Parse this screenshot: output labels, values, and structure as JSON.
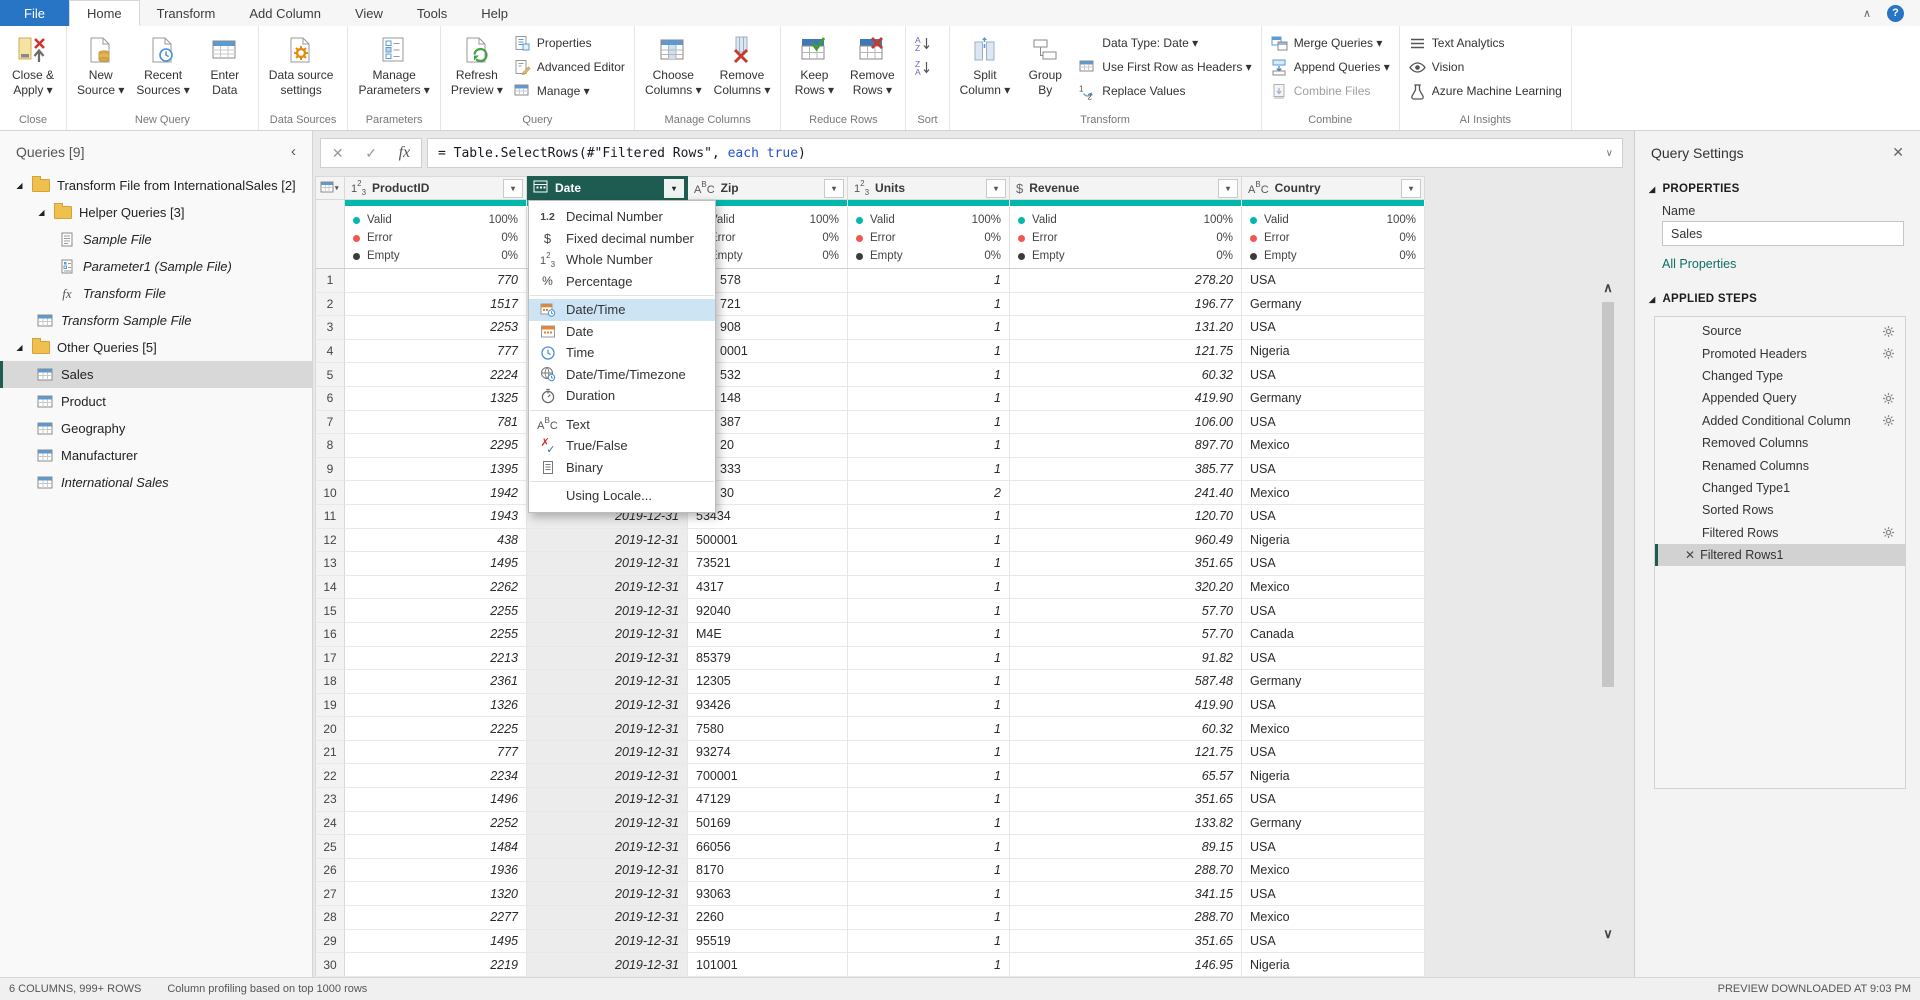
{
  "colors": {
    "accent_teal": "#01b8aa",
    "selected_header": "#1e5c52",
    "file_tab_blue": "#2775c4",
    "error_red": "#f2574f",
    "empty_dark": "#3b3b3b",
    "link_teal": "#0e6f64",
    "menu_highlight": "#cde4f5"
  },
  "glyphs": {
    "dropdown": "▾",
    "collapse_left": "‹",
    "chevron_top": "∧",
    "chevron_up": "∧",
    "chevron_down": "∨",
    "expander": "◢",
    "close": "✕",
    "check": "✓",
    "cancel": "✕",
    "fx": "fx",
    "help": "?"
  },
  "tabs": {
    "items": [
      {
        "label": "File",
        "file": true
      },
      {
        "label": "Home",
        "active": true
      },
      {
        "label": "Transform"
      },
      {
        "label": "Add Column"
      },
      {
        "label": "View"
      },
      {
        "label": "Tools"
      },
      {
        "label": "Help"
      }
    ]
  },
  "ribbon": {
    "groups": [
      {
        "caption": "Close",
        "cols": [
          {
            "type": "bigs",
            "items": [
              {
                "line1": "Close &",
                "line2": "Apply ▾",
                "icon": "close-apply"
              }
            ]
          }
        ]
      },
      {
        "caption": "New Query",
        "cols": [
          {
            "type": "bigs",
            "items": [
              {
                "line1": "New",
                "line2": "Source ▾",
                "icon": "new-source"
              },
              {
                "line1": "Recent",
                "line2": "Sources ▾",
                "icon": "recent-sources"
              },
              {
                "line1": "Enter",
                "line2": "Data",
                "icon": "enter-data"
              }
            ]
          }
        ]
      },
      {
        "caption": "Data Sources",
        "cols": [
          {
            "type": "bigs",
            "items": [
              {
                "line1": "Data source",
                "line2": "settings",
                "icon": "datasource-settings"
              }
            ]
          }
        ]
      },
      {
        "caption": "Parameters",
        "cols": [
          {
            "type": "bigs",
            "items": [
              {
                "line1": "Manage",
                "line2": "Parameters ▾",
                "icon": "manage-parameters"
              }
            ]
          }
        ]
      },
      {
        "caption": "Query",
        "cols": [
          {
            "type": "bigs",
            "items": [
              {
                "line1": "Refresh",
                "line2": "Preview ▾",
                "icon": "refresh-preview"
              }
            ]
          },
          {
            "type": "stack",
            "items": [
              {
                "label": "Properties",
                "icon": "properties"
              },
              {
                "label": "Advanced Editor",
                "icon": "advanced-editor"
              },
              {
                "label": "Manage ▾",
                "icon": "manage-table"
              }
            ]
          }
        ]
      },
      {
        "caption": "Manage Columns",
        "cols": [
          {
            "type": "bigs",
            "items": [
              {
                "line1": "Choose",
                "line2": "Columns ▾",
                "icon": "choose-columns"
              },
              {
                "line1": "Remove",
                "line2": "Columns ▾",
                "icon": "remove-columns"
              }
            ]
          }
        ]
      },
      {
        "caption": "Reduce Rows",
        "cols": [
          {
            "type": "bigs",
            "items": [
              {
                "line1": "Keep",
                "line2": "Rows ▾",
                "icon": "keep-rows"
              },
              {
                "line1": "Remove",
                "line2": "Rows ▾",
                "icon": "remove-rows"
              }
            ]
          }
        ]
      },
      {
        "caption": "Sort",
        "cols": [
          {
            "type": "stack",
            "items": [
              {
                "label": "",
                "icon": "sort-az"
              },
              {
                "label": "",
                "icon": "sort-za"
              }
            ]
          }
        ]
      },
      {
        "caption": "Transform",
        "cols": [
          {
            "type": "bigs",
            "items": [
              {
                "line1": "Split",
                "line2": "Column ▾",
                "icon": "split-column"
              },
              {
                "line1": "Group",
                "line2": "By",
                "icon": "group-by"
              }
            ]
          },
          {
            "type": "stack",
            "items": [
              {
                "label": "Data Type: Date ▾",
                "icon": ""
              },
              {
                "label": "Use First Row as Headers ▾",
                "icon": "use-first-row"
              },
              {
                "label": "Replace Values",
                "icon": "replace-values"
              }
            ]
          }
        ]
      },
      {
        "caption": "Combine",
        "cols": [
          {
            "type": "stack",
            "items": [
              {
                "label": "Merge Queries ▾",
                "icon": "merge-queries"
              },
              {
                "label": "Append Queries ▾",
                "icon": "append-queries"
              },
              {
                "label": "Combine Files",
                "icon": "combine-files",
                "disabled": true
              }
            ]
          }
        ]
      },
      {
        "caption": "AI Insights",
        "cols": [
          {
            "type": "stack",
            "items": [
              {
                "label": "Text Analytics",
                "icon": "text-analytics"
              },
              {
                "label": "Vision",
                "icon": "vision"
              },
              {
                "label": "Azure Machine Learning",
                "icon": "azure-ml"
              }
            ]
          }
        ]
      }
    ]
  },
  "sidebar": {
    "title": "Queries [9]",
    "items": [
      {
        "label": "Transform File from InternationalSales [2]",
        "icon": "folder",
        "indent": 0,
        "expander": true
      },
      {
        "label": "Helper Queries [3]",
        "icon": "folder",
        "indent": 1,
        "expander": true
      },
      {
        "label": "Sample File",
        "icon": "doc",
        "indent": 2,
        "italic": true
      },
      {
        "label": "Parameter1 (Sample File)",
        "icon": "param",
        "indent": 2,
        "italic": true
      },
      {
        "label": "Transform File",
        "icon": "fx",
        "indent": 2,
        "italic": true
      },
      {
        "label": "Transform Sample File",
        "icon": "table",
        "indent": 1,
        "italic": true
      },
      {
        "label": "Other Queries [5]",
        "icon": "folder",
        "indent": 0,
        "expander": true
      },
      {
        "label": "Sales",
        "icon": "table",
        "indent": 1,
        "selected": true
      },
      {
        "label": "Product",
        "icon": "table",
        "indent": 1
      },
      {
        "label": "Geography",
        "icon": "table",
        "indent": 1
      },
      {
        "label": "Manufacturer",
        "icon": "table",
        "indent": 1
      },
      {
        "label": "International Sales",
        "icon": "table",
        "indent": 1,
        "italic": true
      }
    ]
  },
  "formula": {
    "prefix": "= Table.SelectRows(#\"Filtered Rows\", ",
    "keyword": "each true",
    "suffix": ")"
  },
  "table": {
    "columns": [
      {
        "name": "ProductID",
        "icon": "num",
        "stats": {
          "valid": "100%",
          "error": "0%",
          "empty": "0%"
        }
      },
      {
        "name": "Date",
        "icon": "date",
        "selected": true,
        "stats": {
          "valid": "100%",
          "error": "0%",
          "empty": "0%"
        }
      },
      {
        "name": "Zip",
        "icon": "text",
        "stats": {
          "valid": "100%",
          "error": "0%",
          "empty": "0%"
        }
      },
      {
        "name": "Units",
        "icon": "num",
        "stats": {
          "valid": "100%",
          "error": "0%",
          "empty": "0%"
        }
      },
      {
        "name": "Revenue",
        "icon": "currency",
        "stats": {
          "valid": "100%",
          "error": "0%",
          "empty": "0%"
        }
      },
      {
        "name": "Country",
        "icon": "text",
        "stats": {
          "valid": "100%",
          "error": "0%",
          "empty": "0%"
        }
      }
    ],
    "stat_labels": {
      "valid": "Valid",
      "error": "Error",
      "empty": "Empty"
    },
    "zip_fragment_row_count": 10,
    "rows": [
      [
        1,
        "770",
        "2019-12-31",
        "578",
        "1",
        "278.20",
        "USA"
      ],
      [
        2,
        "1517",
        "2019-12-31",
        "721",
        "1",
        "196.77",
        "Germany"
      ],
      [
        3,
        "2253",
        "2019-12-31",
        "908",
        "1",
        "131.20",
        "USA"
      ],
      [
        4,
        "777",
        "2019-12-31",
        "0001",
        "1",
        "121.75",
        "Nigeria"
      ],
      [
        5,
        "2224",
        "2019-12-31",
        "532",
        "1",
        "60.32",
        "USA"
      ],
      [
        6,
        "1325",
        "2019-12-31",
        "148",
        "1",
        "419.90",
        "Germany"
      ],
      [
        7,
        "781",
        "2019-12-31",
        "387",
        "1",
        "106.00",
        "USA"
      ],
      [
        8,
        "2295",
        "2019-12-31",
        "20",
        "1",
        "897.70",
        "Mexico"
      ],
      [
        9,
        "1395",
        "2019-12-31",
        "333",
        "1",
        "385.77",
        "USA"
      ],
      [
        10,
        "1942",
        "2019-12-31",
        "30",
        "2",
        "241.40",
        "Mexico"
      ],
      [
        11,
        "1943",
        "2019-12-31",
        "53434",
        "1",
        "120.70",
        "USA"
      ],
      [
        12,
        "438",
        "2019-12-31",
        "500001",
        "1",
        "960.49",
        "Nigeria"
      ],
      [
        13,
        "1495",
        "2019-12-31",
        "73521",
        "1",
        "351.65",
        "USA"
      ],
      [
        14,
        "2262",
        "2019-12-31",
        "4317",
        "1",
        "320.20",
        "Mexico"
      ],
      [
        15,
        "2255",
        "2019-12-31",
        "92040",
        "1",
        "57.70",
        "USA"
      ],
      [
        16,
        "2255",
        "2019-12-31",
        "M4E",
        "1",
        "57.70",
        "Canada"
      ],
      [
        17,
        "2213",
        "2019-12-31",
        "85379",
        "1",
        "91.82",
        "USA"
      ],
      [
        18,
        "2361",
        "2019-12-31",
        "12305",
        "1",
        "587.48",
        "Germany"
      ],
      [
        19,
        "1326",
        "2019-12-31",
        "93426",
        "1",
        "419.90",
        "USA"
      ],
      [
        20,
        "2225",
        "2019-12-31",
        "7580",
        "1",
        "60.32",
        "Mexico"
      ],
      [
        21,
        "777",
        "2019-12-31",
        "93274",
        "1",
        "121.75",
        "USA"
      ],
      [
        22,
        "2234",
        "2019-12-31",
        "700001",
        "1",
        "65.57",
        "Nigeria"
      ],
      [
        23,
        "1496",
        "2019-12-31",
        "47129",
        "1",
        "351.65",
        "USA"
      ],
      [
        24,
        "2252",
        "2019-12-31",
        "50169",
        "1",
        "133.82",
        "Germany"
      ],
      [
        25,
        "1484",
        "2019-12-31",
        "66056",
        "1",
        "89.15",
        "USA"
      ],
      [
        26,
        "1936",
        "2019-12-31",
        "8170",
        "1",
        "288.70",
        "Mexico"
      ],
      [
        27,
        "1320",
        "2019-12-31",
        "93063",
        "1",
        "341.15",
        "USA"
      ],
      [
        28,
        "2277",
        "2019-12-31",
        "2260",
        "1",
        "288.70",
        "Mexico"
      ],
      [
        29,
        "1495",
        "2019-12-31",
        "95519",
        "1",
        "351.65",
        "USA"
      ],
      [
        30,
        "2219",
        "2019-12-31",
        "101001",
        "1",
        "146.95",
        "Nigeria"
      ]
    ]
  },
  "type_menu": {
    "items": [
      {
        "label": "Decimal Number",
        "icon": "decimal"
      },
      {
        "label": "Fixed decimal number",
        "icon": "fixed"
      },
      {
        "label": "Whole Number",
        "icon": "whole"
      },
      {
        "label": "Percentage",
        "icon": "percent",
        "sep_after": true
      },
      {
        "label": "Date/Time",
        "icon": "datetime",
        "selected": true
      },
      {
        "label": "Date",
        "icon": "date"
      },
      {
        "label": "Time",
        "icon": "time"
      },
      {
        "label": "Date/Time/Timezone",
        "icon": "timezone"
      },
      {
        "label": "Duration",
        "icon": "duration",
        "sep_after": true
      },
      {
        "label": "Text",
        "icon": "abc"
      },
      {
        "label": "True/False",
        "icon": "truefalse"
      },
      {
        "label": "Binary",
        "icon": "binary",
        "sep_after": true
      },
      {
        "label": "Using Locale...",
        "icon": ""
      }
    ]
  },
  "settings_panel": {
    "title": "Query Settings",
    "properties_header": "PROPERTIES",
    "name_label": "Name",
    "name_value": "Sales",
    "all_properties": "All Properties",
    "steps_header": "APPLIED STEPS",
    "steps": [
      {
        "label": "Source",
        "gear": true
      },
      {
        "label": "Promoted Headers",
        "gear": true
      },
      {
        "label": "Changed Type"
      },
      {
        "label": "Appended Query",
        "gear": true
      },
      {
        "label": "Added Conditional Column",
        "gear": true
      },
      {
        "label": "Removed Columns"
      },
      {
        "label": "Renamed Columns"
      },
      {
        "label": "Changed Type1"
      },
      {
        "label": "Sorted Rows"
      },
      {
        "label": "Filtered Rows",
        "gear": true
      },
      {
        "label": "Filtered Rows1",
        "selected": true
      }
    ]
  },
  "status_bar": {
    "left1": "6 COLUMNS, 999+ ROWS",
    "left2": "Column profiling based on top 1000 rows",
    "right": "PREVIEW DOWNLOADED AT 9:03 PM"
  }
}
